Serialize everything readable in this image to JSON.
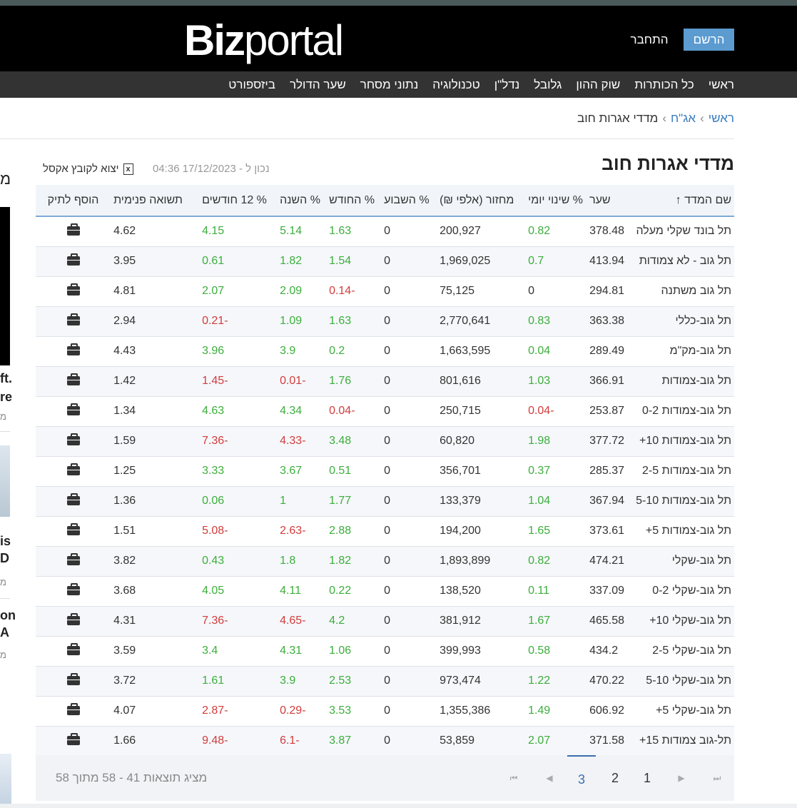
{
  "header": {
    "logo_bold": "Biz",
    "logo_light": "portal",
    "register_label": "הרשם",
    "login_label": "התחבר"
  },
  "nav": [
    "ראשי",
    "כל הכותרות",
    "שוק ההון",
    "גלובל",
    "נדל\"ן",
    "טכנולוגיה",
    "נתוני מסחר",
    "שער הדולר",
    "ביזספורט"
  ],
  "breadcrumb": {
    "home": "ראשי",
    "parent": "אג\"ח",
    "current": "מדדי אגרות חוב"
  },
  "page": {
    "title": "מדדי אגרות חוב",
    "updated": "נכון ל - 17/12/2023 04:36",
    "excel_label": "יצוא לקובץ אקסל"
  },
  "sidebar": {
    "t1": "מ",
    "t2": "ft.",
    "t3": "re",
    "t4": "מ",
    "t5": "is",
    "t6": "D",
    "t7": "מ",
    "t8": "on",
    "t9": "A",
    "t10": "מ"
  },
  "table": {
    "headers": {
      "name": "שם המדד ↑",
      "rate": "שער",
      "daily": "% שינוי יומי",
      "volume": "מחזור (אלפי ₪)",
      "week": "% השבוע",
      "month": "% החודש",
      "year": "% השנה",
      "m12": "% 12 חודשים",
      "ytm": "תשואה פנימית",
      "add": "הוסף לתיק"
    },
    "rows": [
      {
        "name": "תל בונד שקלי מעלה",
        "rate": "378.48",
        "daily": "0.82",
        "volume": "200,927",
        "week": "0",
        "month": "1.63",
        "year": "5.14",
        "m12": "4.15",
        "ytm": "4.62"
      },
      {
        "name": "תל גוב - לא צמודות",
        "rate": "413.94",
        "daily": "0.7",
        "volume": "1,969,025",
        "week": "0",
        "month": "1.54",
        "year": "1.82",
        "m12": "0.61",
        "ytm": "3.95"
      },
      {
        "name": "תל גוב משתנה",
        "rate": "294.81",
        "daily": "0",
        "volume": "75,125",
        "week": "0",
        "month": "-0.14",
        "year": "2.09",
        "m12": "2.07",
        "ytm": "4.81"
      },
      {
        "name": "תל גוב-כללי",
        "rate": "363.38",
        "daily": "0.83",
        "volume": "2,770,641",
        "week": "0",
        "month": "1.63",
        "year": "1.09",
        "m12": "-0.21",
        "ytm": "2.94"
      },
      {
        "name": "תל גוב-מק\"מ",
        "rate": "289.49",
        "daily": "0.04",
        "volume": "1,663,595",
        "week": "0",
        "month": "0.2",
        "year": "3.9",
        "m12": "3.96",
        "ytm": "4.43"
      },
      {
        "name": "תל גוב-צמודות",
        "rate": "366.91",
        "daily": "1.03",
        "volume": "801,616",
        "week": "0",
        "month": "1.76",
        "year": "-0.01",
        "m12": "-1.45",
        "ytm": "1.42"
      },
      {
        "name": "תל גוב-צמודות 0-2",
        "rate": "253.87",
        "daily": "-0.04",
        "volume": "250,715",
        "week": "0",
        "month": "-0.04",
        "year": "4.34",
        "m12": "4.63",
        "ytm": "1.34"
      },
      {
        "name": "תל גוב-צמודות 10+",
        "rate": "377.72",
        "daily": "1.98",
        "volume": "60,820",
        "week": "0",
        "month": "3.48",
        "year": "-4.33",
        "m12": "-7.36",
        "ytm": "1.59"
      },
      {
        "name": "תל גוב-צמודות 2-5",
        "rate": "285.37",
        "daily": "0.37",
        "volume": "356,701",
        "week": "0",
        "month": "0.51",
        "year": "3.67",
        "m12": "3.33",
        "ytm": "1.25"
      },
      {
        "name": "תל גוב-צמודות 5-10",
        "rate": "367.94",
        "daily": "1.04",
        "volume": "133,379",
        "week": "0",
        "month": "1.77",
        "year": "1",
        "m12": "0.06",
        "ytm": "1.36"
      },
      {
        "name": "תל גוב-צמודות 5+",
        "rate": "373.61",
        "daily": "1.65",
        "volume": "194,200",
        "week": "0",
        "month": "2.88",
        "year": "-2.63",
        "m12": "-5.08",
        "ytm": "1.51"
      },
      {
        "name": "תל גוב-שקלי",
        "rate": "474.21",
        "daily": "0.82",
        "volume": "1,893,899",
        "week": "0",
        "month": "1.82",
        "year": "1.8",
        "m12": "0.43",
        "ytm": "3.82"
      },
      {
        "name": "תל גוב-שקלי 0-2",
        "rate": "337.09",
        "daily": "0.11",
        "volume": "138,520",
        "week": "0",
        "month": "0.22",
        "year": "4.11",
        "m12": "4.05",
        "ytm": "3.68"
      },
      {
        "name": "תל גוב-שקלי 10+",
        "rate": "465.58",
        "daily": "1.67",
        "volume": "381,912",
        "week": "0",
        "month": "4.2",
        "year": "-4.65",
        "m12": "-7.36",
        "ytm": "4.31"
      },
      {
        "name": "תל גוב-שקלי 2-5",
        "rate": "434.2",
        "daily": "0.58",
        "volume": "399,993",
        "week": "0",
        "month": "1.06",
        "year": "4.31",
        "m12": "3.4",
        "ytm": "3.59"
      },
      {
        "name": "תל גוב-שקלי 5-10",
        "rate": "470.22",
        "daily": "1.22",
        "volume": "973,474",
        "week": "0",
        "month": "2.53",
        "year": "3.9",
        "m12": "1.61",
        "ytm": "3.72"
      },
      {
        "name": "תל גוב-שקלי 5+",
        "rate": "606.92",
        "daily": "1.49",
        "volume": "1,355,386",
        "week": "0",
        "month": "3.53",
        "year": "-0.29",
        "m12": "-2.87",
        "ytm": "4.07"
      },
      {
        "name": "תל-גוב צמודות 15+",
        "rate": "371.58",
        "daily": "2.07",
        "volume": "53,859",
        "week": "0",
        "month": "3.87",
        "year": "-6.1",
        "m12": "-9.48",
        "ytm": "1.66"
      }
    ]
  },
  "pager": {
    "info": "מציג תוצאות 41 - 58 מתוך 58",
    "pages": [
      "1",
      "2",
      "3"
    ],
    "active": "3",
    "first": "⏮",
    "prev": "◀",
    "next": "▶",
    "last": "⏭"
  },
  "colors": {
    "positive": "#3cae3c",
    "negative": "#d23c3c",
    "accent": "#5b9bd0"
  },
  "icons": {
    "portfolio": "briefcase-icon",
    "excel": "excel-file-icon"
  }
}
